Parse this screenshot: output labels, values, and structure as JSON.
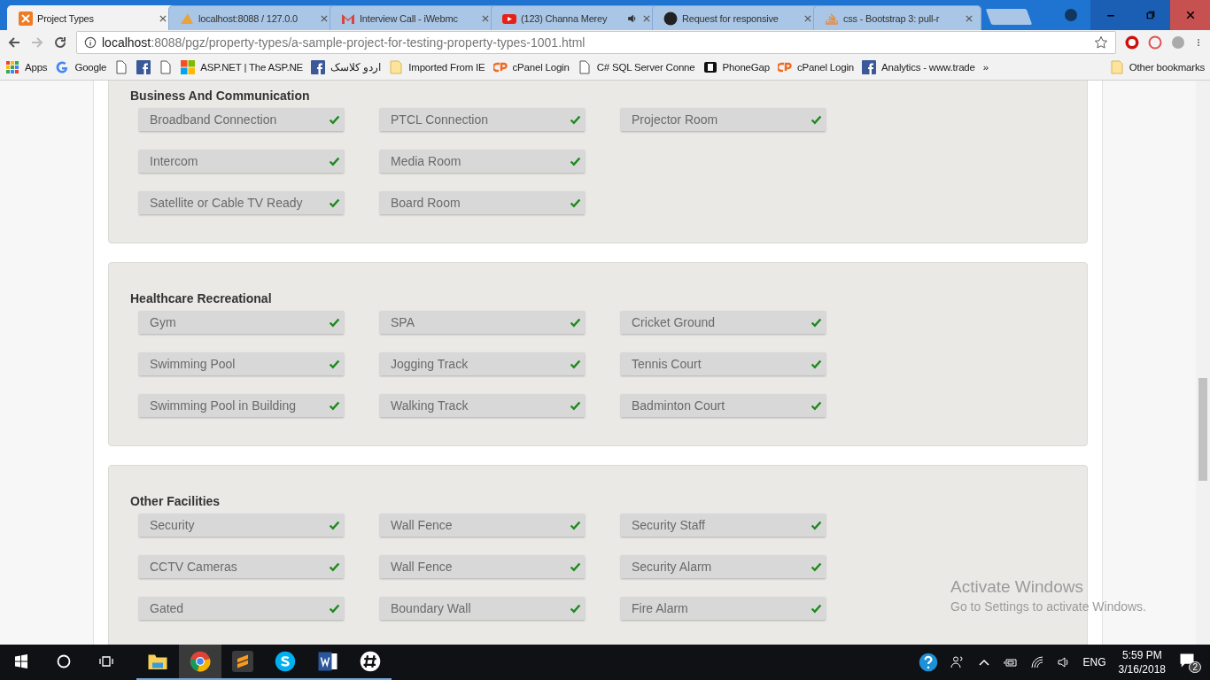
{
  "tabs": [
    {
      "label": "Project Types",
      "selected": true,
      "kind": "xampp"
    },
    {
      "label": "localhost:8088 / 127.0.0",
      "selected": false,
      "kind": "pma"
    },
    {
      "label": "Interview Call - iWebmc",
      "selected": false,
      "kind": "mail"
    },
    {
      "label": "(123) Channa Merey",
      "selected": false,
      "kind": "video",
      "audio": true
    },
    {
      "label": "Request for responsive",
      "selected": false,
      "kind": "github"
    },
    {
      "label": "css - Bootstrap 3: pull-r",
      "selected": false,
      "kind": "stack"
    }
  ],
  "address": {
    "host": "localhost",
    "path": ":8088/pgz/property-types/a-sample-project-for-testing-property-types-1001.html"
  },
  "bookmarks": [
    {
      "kind": "apps",
      "label": "Apps"
    },
    {
      "kind": "google",
      "label": "Google"
    },
    {
      "kind": "page"
    },
    {
      "kind": "facebook"
    },
    {
      "kind": "page"
    },
    {
      "kind": "windows",
      "label": "ASP.NET | The ASP.NE"
    },
    {
      "kind": "facebook",
      "label": "اردو کلاسک"
    },
    {
      "kind": "folder",
      "label": "Imported From IE"
    },
    {
      "kind": "cpanel",
      "label": "cPanel Login"
    },
    {
      "kind": "page",
      "label": "C# SQL Server Conne"
    },
    {
      "kind": "phone",
      "label": "PhoneGap"
    },
    {
      "kind": "cpanel",
      "label": "cPanel Login"
    },
    {
      "kind": "facebook",
      "label": "Analytics - www.trade"
    }
  ],
  "more_bookmarks": "»",
  "other_bookmarks": "Other bookmarks",
  "sections": [
    {
      "title": "Business And Communication",
      "rows": [
        [
          "Broadband Connection",
          "PTCL Connection",
          "Projector Room"
        ],
        [
          "Intercom",
          "Media Room"
        ],
        [
          "Satellite or Cable TV Ready",
          "Board Room"
        ]
      ]
    },
    {
      "title": "Healthcare Recreational",
      "rows": [
        [
          "Gym",
          "SPA",
          "Cricket Ground"
        ],
        [
          "Swimming Pool",
          "Jogging Track",
          "Tennis Court"
        ],
        [
          "Swimming Pool in Building",
          "Walking Track",
          "Badminton Court"
        ]
      ]
    },
    {
      "title": "Other Facilities",
      "rows": [
        [
          "Security",
          "Wall Fence",
          "Security Staff"
        ],
        [
          "CCTV Cameras",
          "Wall Fence",
          "Security Alarm"
        ],
        [
          "Gated",
          "Boundary Wall",
          "Fire Alarm"
        ]
      ]
    }
  ],
  "activation": {
    "title": "Activate Windows",
    "text": "Go to Settings to activate Windows."
  },
  "taskbar": {
    "apps": [
      {
        "kind": "explorer",
        "selected": false
      },
      {
        "kind": "chrome",
        "selected": true
      },
      {
        "kind": "sublime",
        "selected": false
      },
      {
        "kind": "skype",
        "selected": false
      },
      {
        "kind": "word",
        "selected": false
      },
      {
        "kind": "slack",
        "selected": false
      }
    ],
    "language": "ENG",
    "time": "5:59 PM",
    "date": "3/16/2018",
    "notifications": "2"
  }
}
